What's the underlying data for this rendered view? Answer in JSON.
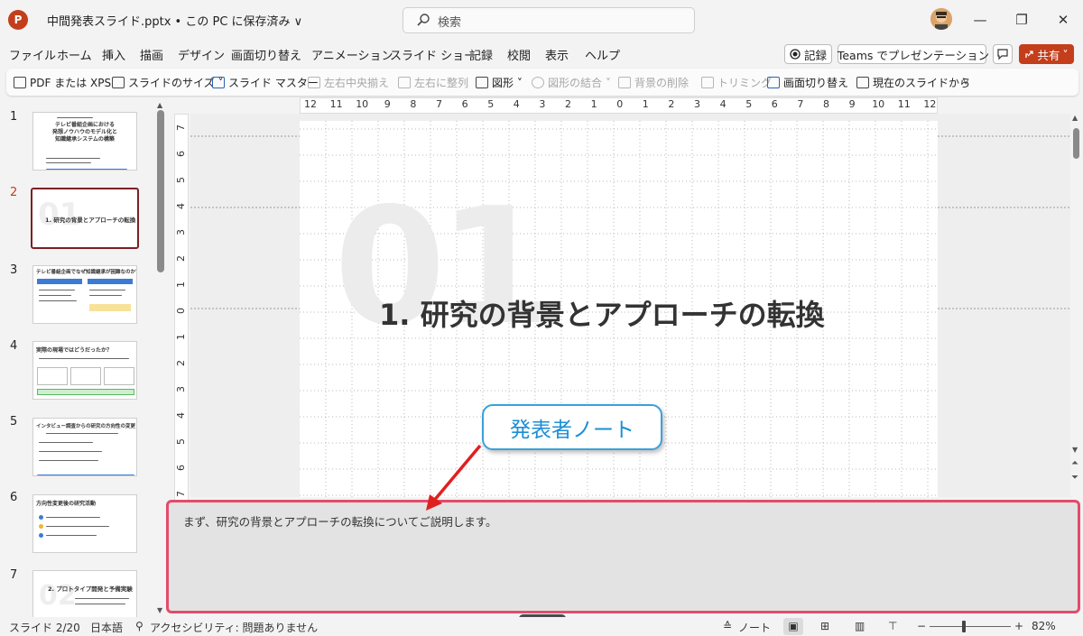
{
  "titlebar": {
    "app_icon": "P",
    "doc_title": "中間発表スライド.pptx • この PC に保存済み ∨",
    "search_placeholder": "検索",
    "minimize": "—",
    "restore": "❐",
    "close": "✕"
  },
  "menu": {
    "tabs": [
      "ファイル",
      "ホーム",
      "挿入",
      "描画",
      "デザイン",
      "画面切り替え",
      "アニメーション",
      "スライド ショー",
      "記録",
      "校閲",
      "表示",
      "ヘルプ"
    ],
    "record_label": "記録",
    "teams_label": "Teams でプレゼンテーション",
    "share_label": "共有"
  },
  "ribbon": {
    "items": [
      {
        "label": "PDF または XPS",
        "enabled": true
      },
      {
        "label": "スライドのサイズ ˅",
        "enabled": true
      },
      {
        "label": "スライド マスター",
        "enabled": true
      },
      {
        "label": "左右中央揃え",
        "enabled": false
      },
      {
        "label": "左右に整列",
        "enabled": false
      },
      {
        "label": "図形 ˅",
        "enabled": true
      },
      {
        "label": "図形の結合 ˅",
        "enabled": false
      },
      {
        "label": "背景の削除",
        "enabled": false
      },
      {
        "label": "トリミング",
        "enabled": false
      },
      {
        "label": "画面切り替え",
        "enabled": true
      },
      {
        "label": "現在のスライドから",
        "enabled": true
      }
    ],
    "more": "▿"
  },
  "thumbnails": [
    {
      "num": "1",
      "title": "テレビ番組企画における\n発想ノウハウのモデル化と\n知識継承システムの構築"
    },
    {
      "num": "2",
      "title": "1. 研究の背景とアプローチの転換",
      "watermark": "01",
      "selected": true
    },
    {
      "num": "3",
      "title": "テレビ番組企画でなぜ知識継承が困難なのか？"
    },
    {
      "num": "4",
      "title": "実際の現場ではどうだったか？"
    },
    {
      "num": "5",
      "title": "インタビュー調査からの研究の方向性の変更"
    },
    {
      "num": "6",
      "title": "方向性変更後の研究活動"
    },
    {
      "num": "7",
      "title": "2. プロトタイプ開発と予備実験",
      "watermark": "02"
    }
  ],
  "ruler": {
    "horizontal": [
      "12",
      "11",
      "10",
      "9",
      "8",
      "7",
      "6",
      "5",
      "4",
      "3",
      "2",
      "1",
      "0",
      "1",
      "2",
      "3",
      "4",
      "5",
      "6",
      "7",
      "8",
      "9",
      "10",
      "11",
      "12"
    ],
    "vertical": [
      "7",
      "6",
      "5",
      "4",
      "3",
      "2",
      "1",
      "0",
      "1",
      "2",
      "3",
      "4",
      "5",
      "6",
      "7"
    ]
  },
  "slide": {
    "watermark": "01",
    "title": "1. 研究の背景とアプローチの転換"
  },
  "callout": {
    "label": "発表者ノート"
  },
  "notes": {
    "text": "まず、研究の背景とアプローチの転換についてご説明します。"
  },
  "status": {
    "slide": "スライド 2/20",
    "language": "日本語",
    "accessibility": "アクセシビリティ: 問題ありません",
    "notes": "ノート",
    "zoom_out": "−",
    "zoom_in": "+",
    "zoom": "82%"
  },
  "colors": {
    "accent": "#c43e1c",
    "notes_border": "#e44b6b",
    "callout": "#3aa0dc",
    "selected_thumb": "#7d1f24"
  }
}
